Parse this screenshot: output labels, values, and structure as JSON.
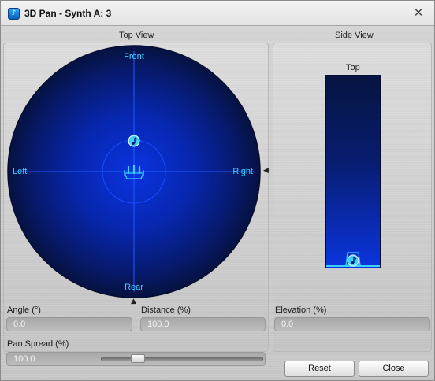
{
  "window": {
    "title": "3D Pan - Synth A: 3",
    "close_glyph": "✕"
  },
  "top_view": {
    "label": "Top View",
    "front": "Front",
    "rear": "Rear",
    "left": "Left",
    "right": "Right"
  },
  "side_view": {
    "label": "Side View",
    "top": "Top"
  },
  "fields": {
    "angle": {
      "label": "Angle (°)",
      "value": "0.0"
    },
    "distance": {
      "label": "Distance (%)",
      "value": "100.0"
    },
    "elevation": {
      "label": "Elevation (%)",
      "value": "0.0"
    },
    "pan_spread": {
      "label": "Pan Spread (%)",
      "value": "100.0",
      "slider_fraction": 0.2
    }
  },
  "buttons": {
    "reset": "Reset",
    "close": "Close"
  },
  "colors": {
    "accent_cyan": "#3ad0ff",
    "pad_blue": "#0a2fd0"
  },
  "icons": {
    "app": "music-note-icon",
    "source": "music-note-icon",
    "listener": "listener-head-icon"
  }
}
